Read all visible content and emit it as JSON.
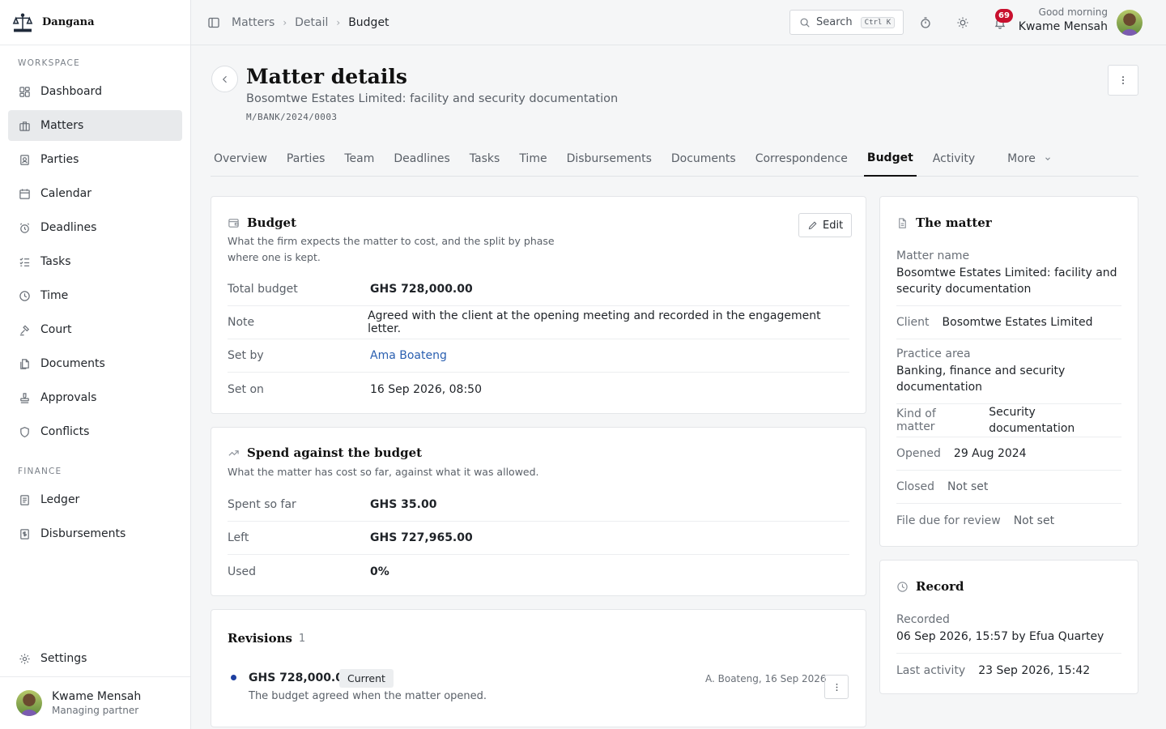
{
  "app": {
    "name": "Dangana"
  },
  "sidebar": {
    "workspace_label": "WORKSPACE",
    "workspace_items": [
      {
        "label": "Dashboard",
        "icon": "dashboard-icon"
      },
      {
        "label": "Matters",
        "icon": "briefcase-icon",
        "active": true
      },
      {
        "label": "Parties",
        "icon": "contact-icon"
      },
      {
        "label": "Calendar",
        "icon": "calendar-icon"
      },
      {
        "label": "Deadlines",
        "icon": "alarm-icon"
      },
      {
        "label": "Tasks",
        "icon": "tasks-icon"
      },
      {
        "label": "Time",
        "icon": "clock-icon"
      },
      {
        "label": "Court",
        "icon": "gavel-icon"
      },
      {
        "label": "Documents",
        "icon": "documents-icon"
      },
      {
        "label": "Approvals",
        "icon": "stamp-icon"
      },
      {
        "label": "Conflicts",
        "icon": "shield-icon"
      }
    ],
    "finance_label": "FINANCE",
    "finance_items": [
      {
        "label": "Ledger",
        "icon": "ledger-icon"
      },
      {
        "label": "Disbursements",
        "icon": "receipt-icon"
      }
    ],
    "settings_label": "Settings",
    "user": {
      "name": "Kwame Mensah",
      "role": "Managing partner"
    }
  },
  "topbar": {
    "breadcrumbs": [
      "Matters",
      "Detail",
      "Budget"
    ],
    "search_label": "Search",
    "search_shortcut": "Ctrl K",
    "notification_count": "69",
    "greeting": "Good morning",
    "user_name": "Kwame Mensah"
  },
  "header": {
    "title": "Matter details",
    "subtitle": "Bosomtwe Estates Limited: facility and security documentation",
    "reference": "M/BANK/2024/0003"
  },
  "tabs": [
    {
      "label": "Overview"
    },
    {
      "label": "Parties"
    },
    {
      "label": "Team"
    },
    {
      "label": "Deadlines"
    },
    {
      "label": "Tasks"
    },
    {
      "label": "Time"
    },
    {
      "label": "Disbursements"
    },
    {
      "label": "Documents"
    },
    {
      "label": "Correspondence"
    },
    {
      "label": "Budget",
      "active": true
    },
    {
      "label": "Activity"
    }
  ],
  "more_tab_label": "More",
  "budget_card": {
    "title": "Budget",
    "description_line1": "What the firm expects the matter to cost, and the split by phase",
    "description_line2": "where one is kept.",
    "edit_label": "Edit",
    "rows": [
      {
        "label": "Total budget",
        "value": "GHS 728,000.00"
      },
      {
        "label": "Note",
        "value": "Agreed with the client at the opening meeting and recorded in the engagement letter."
      },
      {
        "label": "Set by",
        "value": "Ama Boateng"
      },
      {
        "label": "Set on",
        "value": "16 Sep 2026, 08:50"
      }
    ]
  },
  "spend_card": {
    "title": "Spend against the budget",
    "description": "What the matter has cost so far, against what it was allowed.",
    "rows": [
      {
        "label": "Spent so far",
        "value": "GHS 35.00"
      },
      {
        "label": "Left",
        "value": "GHS 727,965.00"
      },
      {
        "label": "Used",
        "value": "0%"
      }
    ]
  },
  "revisions_card": {
    "title": "Revisions",
    "count": "1",
    "items": [
      {
        "amount": "GHS 728,000.00",
        "tag": "Current",
        "meta": "A. Boateng, 16 Sep 2026",
        "description": "The budget agreed when the matter opened."
      }
    ]
  },
  "matter_card": {
    "title": "The matter",
    "rows": [
      {
        "label": "Matter name",
        "value": "Bosomtwe Estates Limited: facility and security documentation"
      },
      {
        "label": "Client",
        "value": "Bosomtwe Estates Limited"
      },
      {
        "label": "Practice area",
        "value": "Banking, finance and security documentation"
      },
      {
        "label": "Kind of matter",
        "value": "Security documentation"
      },
      {
        "label": "Opened",
        "value": "29 Aug 2024"
      },
      {
        "label": "Closed",
        "value": "Not set"
      },
      {
        "label": "File due for review",
        "value": "Not set"
      }
    ]
  },
  "record_card": {
    "title": "Record",
    "rows": [
      {
        "label": "Recorded",
        "value": "06 Sep 2026, 15:57 by Efua Quartey"
      },
      {
        "label": "Last activity",
        "value": "23 Sep 2026, 15:42"
      }
    ]
  },
  "colors": {
    "accent_link": "#2a5fb0",
    "badge_red": "#c8102e",
    "revision_dot": "#1e3fa0"
  }
}
